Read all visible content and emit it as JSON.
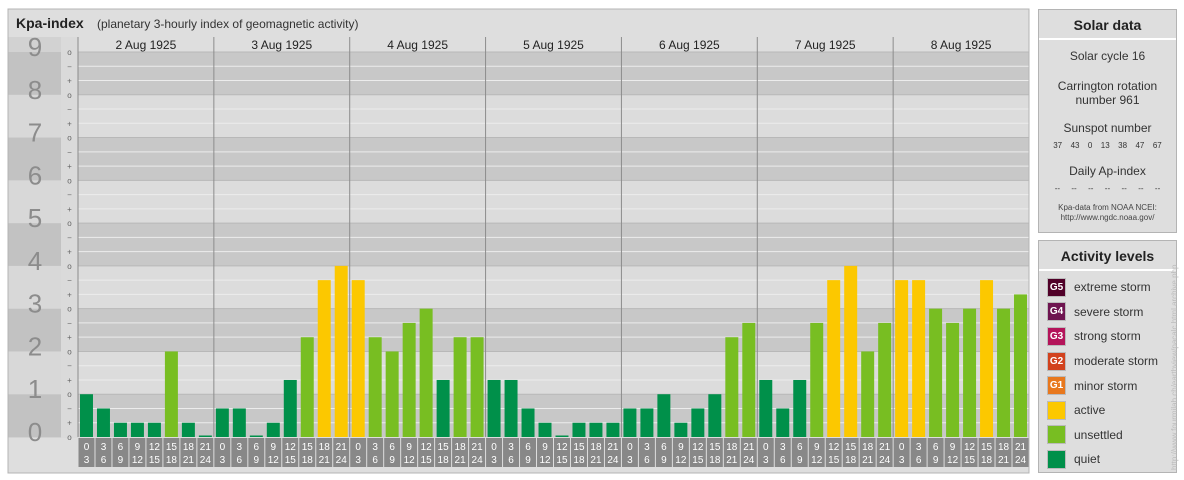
{
  "chart_data": {
    "type": "bar",
    "title": "Kpa-index",
    "subtitle": "(planetary 3-hourly index of geomagnetic activity)",
    "ylim": [
      0,
      9
    ],
    "y_ticks": [
      "0",
      "1",
      "2",
      "3",
      "4",
      "5",
      "6",
      "7",
      "8",
      "9"
    ],
    "y_minor_ticks": [
      "o",
      "+",
      "−"
    ],
    "days": [
      "2 Aug 1925",
      "3 Aug 1925",
      "4 Aug 1925",
      "5 Aug 1925",
      "6 Aug 1925",
      "7 Aug 1925",
      "8 Aug 1925"
    ],
    "interval_start": [
      "0",
      "3",
      "6",
      "9",
      "12",
      "15",
      "18",
      "21"
    ],
    "interval_end": [
      "3",
      "6",
      "9",
      "12",
      "15",
      "18",
      "21",
      "24"
    ],
    "values": [
      [
        1,
        0.667,
        0.333,
        0.333,
        0.333,
        2,
        0.333,
        0
      ],
      [
        0.667,
        0.667,
        0,
        0.333,
        1.333,
        2.333,
        3.667,
        4
      ],
      [
        3.667,
        2.333,
        2,
        2.667,
        3,
        1.333,
        2.333,
        2.333
      ],
      [
        1.333,
        1.333,
        0.667,
        0.333,
        0,
        0.333,
        0.333,
        0.333
      ],
      [
        0.667,
        0.667,
        1,
        0.333,
        0.667,
        1,
        2.333,
        2.667
      ],
      [
        1.333,
        0.667,
        1.333,
        2.667,
        3.667,
        4,
        2,
        2.667
      ],
      [
        3.667,
        3.667,
        3,
        2.667,
        3,
        3.667,
        3,
        3.333
      ]
    ],
    "level_colors": {
      "quiet": "#00904a",
      "unsettled": "#78be22",
      "active": "#fcc800",
      "minor_storm": "#e8781e",
      "moderate_storm": "#d2421e",
      "strong_storm": "#b4145a",
      "severe_storm": "#6e1450",
      "extreme_storm": "#500028"
    }
  },
  "solar_data": {
    "title": "Solar data",
    "solar_cycle": "Solar cycle 16",
    "carrington_line1": "Carrington rotation",
    "carrington_line2": "number 961",
    "sunspot_label": "Sunspot number",
    "sunspot_values": [
      "37",
      "43",
      "0",
      "13",
      "38",
      "47",
      "67"
    ],
    "ap_label": "Daily Ap-index",
    "ap_values": [
      "--",
      "--",
      "--",
      "--",
      "--",
      "--",
      "--"
    ],
    "source_line1": "Kpa-data from NOAA NCEI:",
    "source_line2": "http://www.ngdc.noaa.gov/"
  },
  "activity_levels": {
    "title": "Activity levels",
    "items": [
      {
        "code": "G5",
        "label": "extreme storm",
        "color": "#500028"
      },
      {
        "code": "G4",
        "label": "severe storm",
        "color": "#6e1450"
      },
      {
        "code": "G3",
        "label": "strong storm",
        "color": "#b4145a"
      },
      {
        "code": "G2",
        "label": "moderate storm",
        "color": "#d2421e"
      },
      {
        "code": "G1",
        "label": "minor storm",
        "color": "#e8781e"
      },
      {
        "code": "",
        "label": "active",
        "color": "#fcc800"
      },
      {
        "code": "",
        "label": "unsettled",
        "color": "#78be22"
      },
      {
        "code": "",
        "label": "quiet",
        "color": "#00904a"
      }
    ]
  },
  "credit": "http://www.fourmilab.ch/earthview/pacalc.html  archive.php"
}
